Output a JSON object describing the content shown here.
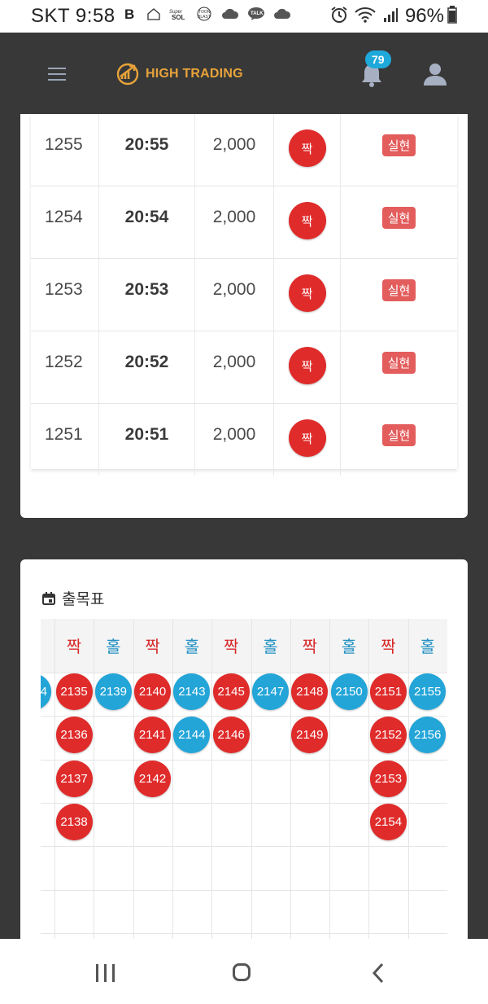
{
  "status_bar": {
    "carrier": "SKT",
    "time": "9:58",
    "battery": "96%"
  },
  "app": {
    "title": "HIGH TRADING",
    "notification_count": "79",
    "accent_color": "#e7a33a",
    "badge_color": "#1fa8da"
  },
  "history": {
    "rows": [
      {
        "no": "1255",
        "time": "20:55",
        "amount": "2,000",
        "pick": "짝",
        "result": "실현"
      },
      {
        "no": "1254",
        "time": "20:54",
        "amount": "2,000",
        "pick": "짝",
        "result": "실현"
      },
      {
        "no": "1253",
        "time": "20:53",
        "amount": "2,000",
        "pick": "짝",
        "result": "실현"
      },
      {
        "no": "1252",
        "time": "20:52",
        "amount": "2,000",
        "pick": "짝",
        "result": "실현"
      },
      {
        "no": "1251",
        "time": "20:51",
        "amount": "2,000",
        "pick": "짝",
        "result": "실현"
      }
    ]
  },
  "chart": {
    "title": "출목표",
    "partial_ball_label": "4",
    "columns": [
      {
        "label": "짝",
        "color": "red",
        "balls": [
          "2135",
          "2136",
          "2137",
          "2138"
        ]
      },
      {
        "label": "홀",
        "color": "blue",
        "balls": [
          "2139"
        ]
      },
      {
        "label": "짝",
        "color": "red",
        "balls": [
          "2140",
          "2141",
          "2142"
        ]
      },
      {
        "label": "홀",
        "color": "blue",
        "balls": [
          "2143",
          "2144"
        ]
      },
      {
        "label": "짝",
        "color": "red",
        "balls": [
          "2145",
          "2146"
        ]
      },
      {
        "label": "홀",
        "color": "blue",
        "balls": [
          "2147"
        ]
      },
      {
        "label": "짝",
        "color": "red",
        "balls": [
          "2148",
          "2149"
        ]
      },
      {
        "label": "홀",
        "color": "blue",
        "balls": [
          "2150"
        ]
      },
      {
        "label": "짝",
        "color": "red",
        "balls": [
          "2151",
          "2152",
          "2153",
          "2154"
        ]
      },
      {
        "label": "홀",
        "color": "blue",
        "balls": [
          "2155",
          "2156"
        ]
      }
    ]
  }
}
